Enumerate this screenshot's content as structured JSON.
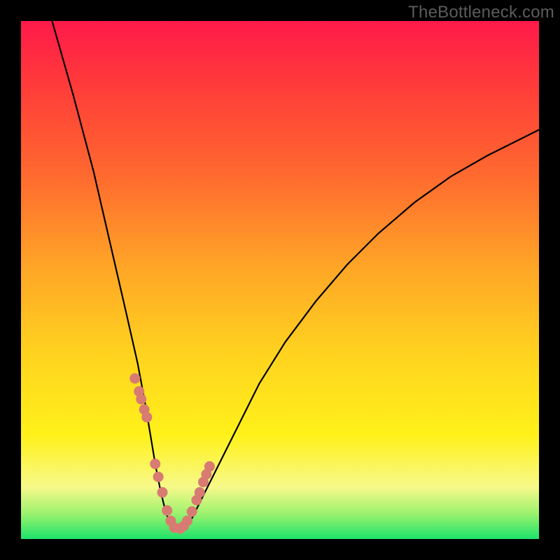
{
  "watermark": "TheBottleneck.com",
  "chart_data": {
    "type": "line",
    "title": "",
    "xlabel": "",
    "ylabel": "",
    "xlim": [
      0,
      100
    ],
    "ylim": [
      0,
      100
    ],
    "curve": {
      "x": [
        6,
        10,
        14,
        17,
        20,
        22.5,
        24,
        25,
        26,
        27,
        28,
        29,
        30,
        31.5,
        33,
        35,
        38,
        42,
        46,
        51,
        57,
        63,
        69,
        76,
        83,
        90,
        97,
        100
      ],
      "y": [
        100,
        86,
        71,
        58,
        45,
        34,
        26,
        20,
        14,
        9,
        5,
        2.5,
        1.5,
        2,
        4,
        8,
        14,
        22,
        30,
        38,
        46,
        53,
        59,
        65,
        70,
        74,
        77.5,
        79
      ]
    },
    "scatter": {
      "x": [
        22,
        22.8,
        23.2,
        23.8,
        24.3,
        25.9,
        26.5,
        27.3,
        28.2,
        28.9,
        29.6,
        30.7,
        31.4,
        32.1,
        33.0,
        33.9,
        34.5,
        35.2,
        35.8,
        36.4
      ],
      "y": [
        31,
        28.5,
        27,
        25,
        23.5,
        14.5,
        12,
        9,
        5.5,
        3.5,
        2.2,
        2.0,
        2.5,
        3.5,
        5.3,
        7.5,
        9.0,
        11,
        12.5,
        14
      ]
    },
    "colors": {
      "curve": "#000000",
      "scatter": "#d87b72",
      "gradient_top": "#ff1a4a",
      "gradient_bottom": "#1de36a"
    }
  }
}
